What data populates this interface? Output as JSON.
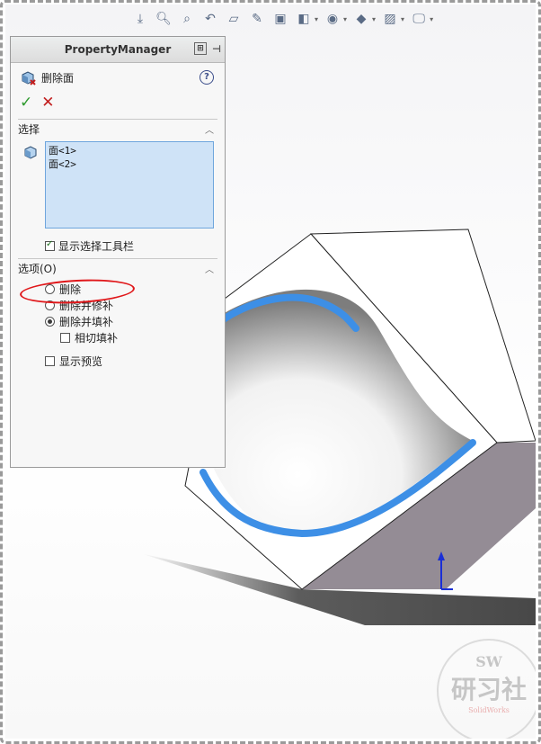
{
  "toolbar": {
    "icons": [
      "view-orientation-icon",
      "zoom-to-fit-icon",
      "zoom-area-icon",
      "previous-view-icon",
      "section-view-icon",
      "dynamic-annotation-icon",
      "view-cube-icon",
      "display-style-icon",
      "hide-show-icon",
      "edit-appearance-icon",
      "apply-scene-icon",
      "view-settings-icon",
      "monitor-icon"
    ]
  },
  "panel": {
    "header_title": "PropertyManager",
    "feature_title": "删除面",
    "help_label": "?",
    "ok_label": "✓",
    "cancel_label": "✕",
    "selection_group": {
      "title": "选择",
      "items": [
        "面<1>",
        "面<2>"
      ],
      "show_toolbar_label": "显示选择工具栏",
      "show_toolbar_checked": true
    },
    "options_group": {
      "title": "选项(O)",
      "radios": [
        {
          "label": "删除",
          "selected": false
        },
        {
          "label": "删除并修补",
          "selected": false
        },
        {
          "label": "删除并填补",
          "selected": true
        }
      ],
      "tangent_fill_label": "相切填补",
      "tangent_fill_checked": false,
      "show_preview_label": "显示预览",
      "show_preview_checked": false
    }
  },
  "watermark": {
    "sw": "SW",
    "main": "研习社",
    "sub": "SolidWorks"
  },
  "colors": {
    "selection_bg": "#cfe3f7",
    "highlight_face": "#3d8fe6",
    "annotation_red": "#e0171a",
    "triad_blue": "#1a2fd6"
  }
}
